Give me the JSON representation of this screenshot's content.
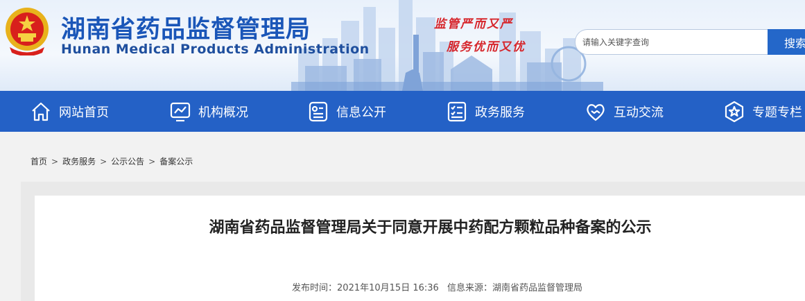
{
  "header": {
    "title_cn": "湖南省药品监督管理局",
    "title_en": "Hunan Medical Products Administration",
    "slogan_line1": "监管严而又严",
    "slogan_line2": "服务优而又优",
    "emblem_icon": "national-emblem-icon"
  },
  "search": {
    "placeholder": "请输入关键字查询",
    "button_label": "搜索"
  },
  "nav": {
    "items": [
      {
        "label": "网站首页",
        "icon": "home-icon"
      },
      {
        "label": "机构概况",
        "icon": "chart-monitor-icon"
      },
      {
        "label": "信息公开",
        "icon": "info-card-icon"
      },
      {
        "label": "政务服务",
        "icon": "checklist-icon"
      },
      {
        "label": "互动交流",
        "icon": "heart-handshake-icon"
      },
      {
        "label": "专题专栏",
        "icon": "star-badge-icon"
      }
    ]
  },
  "breadcrumb": {
    "items": [
      "首页",
      "政务服务",
      "公示公告",
      "备案公示"
    ],
    "separator": ">"
  },
  "article": {
    "title": "湖南省药品监督管理局关于同意开展中药配方颗粒品种备案的公示",
    "publish_label": "发布时间：2021年10月15日 16:36",
    "source_label": "信息来源：湖南省药品监督管理局"
  },
  "colors": {
    "nav_bg": "#2461c6",
    "title_blue": "#1a56b8",
    "slogan_red": "#d6262c"
  }
}
